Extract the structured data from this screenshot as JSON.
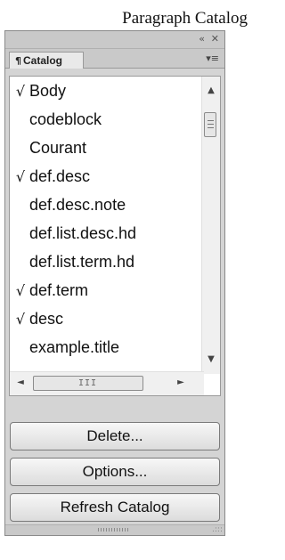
{
  "window": {
    "title": "Paragraph Catalog"
  },
  "topbar": {
    "collapse_glyph": "«",
    "close_glyph": "✕"
  },
  "tab": {
    "icon": "¶",
    "label": "Catalog",
    "menu_glyph": "▾≡"
  },
  "list": {
    "check_glyph": "√",
    "items": [
      {
        "label": "Body",
        "checked": true
      },
      {
        "label": "codeblock",
        "checked": false
      },
      {
        "label": "Courant",
        "checked": false
      },
      {
        "label": "def.desc",
        "checked": true
      },
      {
        "label": "def.desc.note",
        "checked": false
      },
      {
        "label": "def.list.desc.hd",
        "checked": false
      },
      {
        "label": "def.list.term.hd",
        "checked": false
      },
      {
        "label": "def.term",
        "checked": true
      },
      {
        "label": "desc",
        "checked": true
      },
      {
        "label": "example.title",
        "checked": false
      }
    ]
  },
  "scroll": {
    "up": "▲",
    "down": "▼",
    "left": "◄",
    "right": "►",
    "hthumb_glyph": "III"
  },
  "buttons": {
    "delete": "Delete...",
    "options": "Options...",
    "refresh": "Refresh Catalog"
  },
  "resize_glyph": ".:::"
}
